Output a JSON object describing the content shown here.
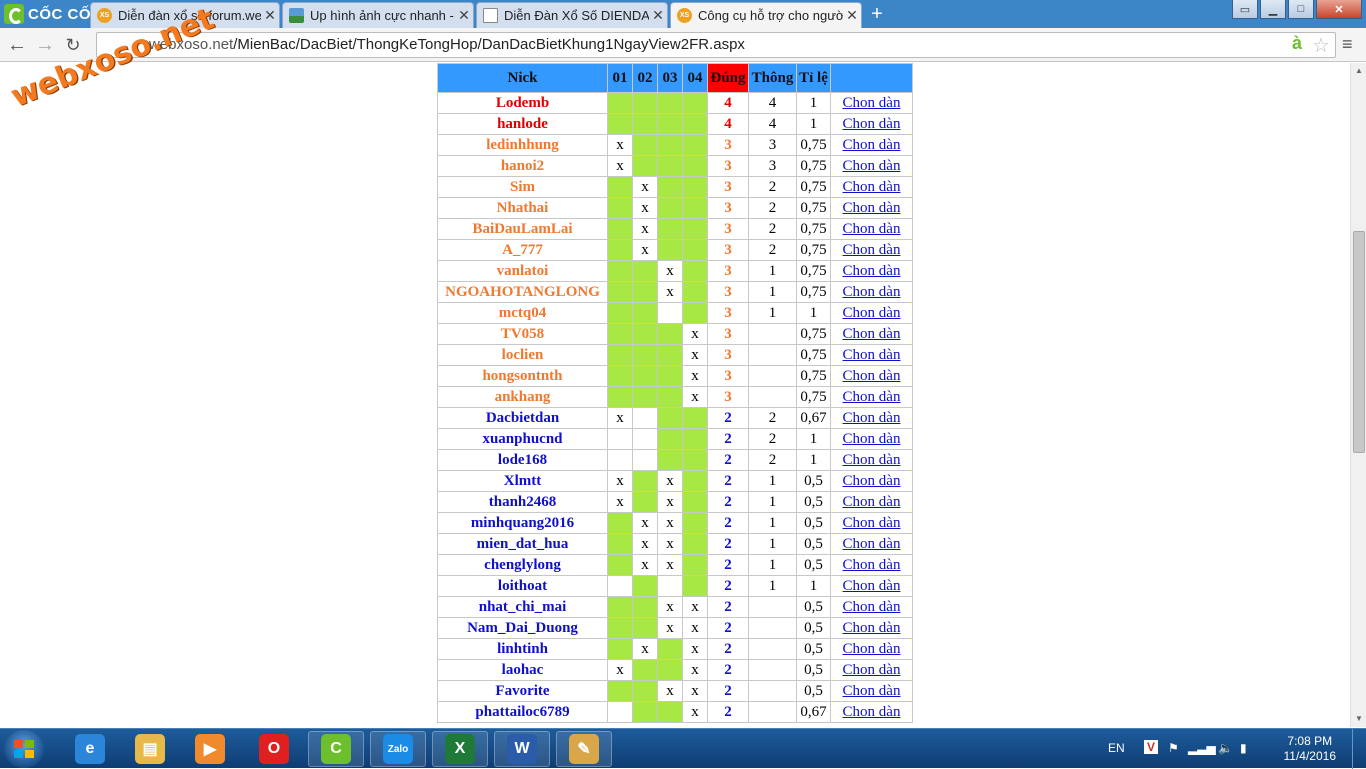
{
  "browser": {
    "brand": "CỐC CỐC",
    "tabs": [
      {
        "label": "Diễn đàn xổ số forum.web",
        "icon": "xs"
      },
      {
        "label": "Up hình ảnh cực nhanh - U",
        "icon": "img"
      },
      {
        "label": "Diễn Đàn Xổ Số DIENDAN",
        "icon": "doc"
      },
      {
        "label": "Công cụ hỗ trợ cho người",
        "icon": "xs"
      }
    ],
    "url_host": "webxoso.net",
    "url_path": "/MienBac/DacBiet/ThongKeTongHop/DanDacBietKhung1NgayView2FR.aspx"
  },
  "watermark": "webxoso.net",
  "table": {
    "headers": [
      "Nick",
      "01",
      "02",
      "03",
      "04",
      "Đúng",
      "Thông",
      "Tỉ lệ",
      ""
    ],
    "link_label": "Chon dàn",
    "rows": [
      {
        "nick": "Lodemb",
        "p": [
          "",
          "",
          "",
          ""
        ],
        "g": [
          1,
          1,
          1,
          1
        ],
        "dung": "4",
        "thong": "4",
        "tile": "1",
        "lvl": 4
      },
      {
        "nick": "hanlode",
        "p": [
          "",
          "",
          "",
          ""
        ],
        "g": [
          1,
          1,
          1,
          1
        ],
        "dung": "4",
        "thong": "4",
        "tile": "1",
        "lvl": 4
      },
      {
        "nick": "ledinhhung",
        "p": [
          "x",
          "",
          "",
          ""
        ],
        "g": [
          0,
          1,
          1,
          1
        ],
        "dung": "3",
        "thong": "3",
        "tile": "0,75",
        "lvl": 3
      },
      {
        "nick": "hanoi2",
        "p": [
          "x",
          "",
          "",
          ""
        ],
        "g": [
          0,
          1,
          1,
          1
        ],
        "dung": "3",
        "thong": "3",
        "tile": "0,75",
        "lvl": 3
      },
      {
        "nick": "Sim",
        "p": [
          "",
          "x",
          "",
          ""
        ],
        "g": [
          1,
          0,
          1,
          1
        ],
        "dung": "3",
        "thong": "2",
        "tile": "0,75",
        "lvl": 3
      },
      {
        "nick": "Nhathai",
        "p": [
          "",
          "x",
          "",
          ""
        ],
        "g": [
          1,
          0,
          1,
          1
        ],
        "dung": "3",
        "thong": "2",
        "tile": "0,75",
        "lvl": 3
      },
      {
        "nick": "BaiDauLamLai",
        "p": [
          "",
          "x",
          "",
          ""
        ],
        "g": [
          1,
          0,
          1,
          1
        ],
        "dung": "3",
        "thong": "2",
        "tile": "0,75",
        "lvl": 3
      },
      {
        "nick": "A_777",
        "p": [
          "",
          "x",
          "",
          ""
        ],
        "g": [
          1,
          0,
          1,
          1
        ],
        "dung": "3",
        "thong": "2",
        "tile": "0,75",
        "lvl": 3
      },
      {
        "nick": "vanlatoi",
        "p": [
          "",
          "",
          "x",
          ""
        ],
        "g": [
          1,
          1,
          0,
          1
        ],
        "dung": "3",
        "thong": "1",
        "tile": "0,75",
        "lvl": 3
      },
      {
        "nick": "NGOAHOTANGLONG",
        "p": [
          "",
          "",
          "x",
          ""
        ],
        "g": [
          1,
          1,
          0,
          1
        ],
        "dung": "3",
        "thong": "1",
        "tile": "0,75",
        "lvl": 3
      },
      {
        "nick": "mctq04",
        "p": [
          "",
          "",
          "",
          ""
        ],
        "g": [
          1,
          1,
          0,
          1
        ],
        "dung": "3",
        "thong": "1",
        "tile": "1",
        "lvl": 3
      },
      {
        "nick": "TV058",
        "p": [
          "",
          "",
          "",
          "x"
        ],
        "g": [
          1,
          1,
          1,
          0
        ],
        "dung": "3",
        "thong": "",
        "tile": "0,75",
        "lvl": 3
      },
      {
        "nick": "loclien",
        "p": [
          "",
          "",
          "",
          "x"
        ],
        "g": [
          1,
          1,
          1,
          0
        ],
        "dung": "3",
        "thong": "",
        "tile": "0,75",
        "lvl": 3
      },
      {
        "nick": "hongsontnth",
        "p": [
          "",
          "",
          "",
          "x"
        ],
        "g": [
          1,
          1,
          1,
          0
        ],
        "dung": "3",
        "thong": "",
        "tile": "0,75",
        "lvl": 3
      },
      {
        "nick": "ankhang",
        "p": [
          "",
          "",
          "",
          "x"
        ],
        "g": [
          1,
          1,
          1,
          0
        ],
        "dung": "3",
        "thong": "",
        "tile": "0,75",
        "lvl": 3
      },
      {
        "nick": "Dacbietdan",
        "p": [
          "x",
          "",
          "",
          ""
        ],
        "g": [
          0,
          0,
          1,
          1
        ],
        "dung": "2",
        "thong": "2",
        "tile": "0,67",
        "lvl": 2
      },
      {
        "nick": "xuanphucnd",
        "p": [
          "",
          "",
          "",
          ""
        ],
        "g": [
          0,
          0,
          1,
          1
        ],
        "dung": "2",
        "thong": "2",
        "tile": "1",
        "lvl": 2
      },
      {
        "nick": "lode168",
        "p": [
          "",
          "",
          "",
          ""
        ],
        "g": [
          0,
          0,
          1,
          1
        ],
        "dung": "2",
        "thong": "2",
        "tile": "1",
        "lvl": 2
      },
      {
        "nick": "Xlmtt",
        "p": [
          "x",
          "",
          "x",
          ""
        ],
        "g": [
          0,
          1,
          0,
          1
        ],
        "dung": "2",
        "thong": "1",
        "tile": "0,5",
        "lvl": 2
      },
      {
        "nick": "thanh2468",
        "p": [
          "x",
          "",
          "x",
          ""
        ],
        "g": [
          0,
          1,
          0,
          1
        ],
        "dung": "2",
        "thong": "1",
        "tile": "0,5",
        "lvl": 2
      },
      {
        "nick": "minhquang2016",
        "p": [
          "",
          "x",
          "x",
          ""
        ],
        "g": [
          1,
          0,
          0,
          1
        ],
        "dung": "2",
        "thong": "1",
        "tile": "0,5",
        "lvl": 2
      },
      {
        "nick": "mien_dat_hua",
        "p": [
          "",
          "x",
          "x",
          ""
        ],
        "g": [
          1,
          0,
          0,
          1
        ],
        "dung": "2",
        "thong": "1",
        "tile": "0,5",
        "lvl": 2
      },
      {
        "nick": "chenglylong",
        "p": [
          "",
          "x",
          "x",
          ""
        ],
        "g": [
          1,
          0,
          0,
          1
        ],
        "dung": "2",
        "thong": "1",
        "tile": "0,5",
        "lvl": 2
      },
      {
        "nick": "loithoat",
        "p": [
          "",
          "",
          "",
          ""
        ],
        "g": [
          0,
          1,
          0,
          1
        ],
        "dung": "2",
        "thong": "1",
        "tile": "1",
        "lvl": 2
      },
      {
        "nick": "nhat_chi_mai",
        "p": [
          "",
          "",
          "x",
          "x"
        ],
        "g": [
          1,
          1,
          0,
          0
        ],
        "dung": "2",
        "thong": "",
        "tile": "0,5",
        "lvl": 2
      },
      {
        "nick": "Nam_Dai_Duong",
        "p": [
          "",
          "",
          "x",
          "x"
        ],
        "g": [
          1,
          1,
          0,
          0
        ],
        "dung": "2",
        "thong": "",
        "tile": "0,5",
        "lvl": 2
      },
      {
        "nick": "linhtinh",
        "p": [
          "",
          "x",
          "",
          "x"
        ],
        "g": [
          1,
          0,
          1,
          0
        ],
        "dung": "2",
        "thong": "",
        "tile": "0,5",
        "lvl": 2
      },
      {
        "nick": "laohac",
        "p": [
          "x",
          "",
          "",
          "x"
        ],
        "g": [
          0,
          1,
          1,
          0
        ],
        "dung": "2",
        "thong": "",
        "tile": "0,5",
        "lvl": 2
      },
      {
        "nick": "Favorite",
        "p": [
          "",
          "",
          "x",
          "x"
        ],
        "g": [
          1,
          1,
          0,
          0
        ],
        "dung": "2",
        "thong": "",
        "tile": "0,5",
        "lvl": 2
      },
      {
        "nick": "phattailoc6789",
        "p": [
          "",
          "",
          "",
          "x"
        ],
        "g": [
          0,
          1,
          1,
          0
        ],
        "dung": "2",
        "thong": "",
        "tile": "0,67",
        "lvl": 2
      }
    ]
  },
  "taskbar": {
    "apps": [
      {
        "name": "ie-icon",
        "color": "#2b86d9",
        "glyph": "e"
      },
      {
        "name": "explorer-icon",
        "color": "#e7b84a",
        "glyph": "▤"
      },
      {
        "name": "media-player-icon",
        "color": "#f08a2c",
        "glyph": "▶"
      },
      {
        "name": "opera-icon",
        "color": "#e02020",
        "glyph": "O"
      },
      {
        "name": "coccoc-icon",
        "color": "#6dbf2e",
        "glyph": "C"
      },
      {
        "name": "zalo-icon",
        "color": "#1a8ce6",
        "glyph": "Zalo"
      },
      {
        "name": "excel-icon",
        "color": "#1f7a3a",
        "glyph": "X"
      },
      {
        "name": "word-icon",
        "color": "#2a5caa",
        "glyph": "W"
      },
      {
        "name": "paint-icon",
        "color": "#d9a64a",
        "glyph": "✎"
      }
    ],
    "lang": "EN",
    "time": "7:08 PM",
    "date": "11/4/2016"
  }
}
